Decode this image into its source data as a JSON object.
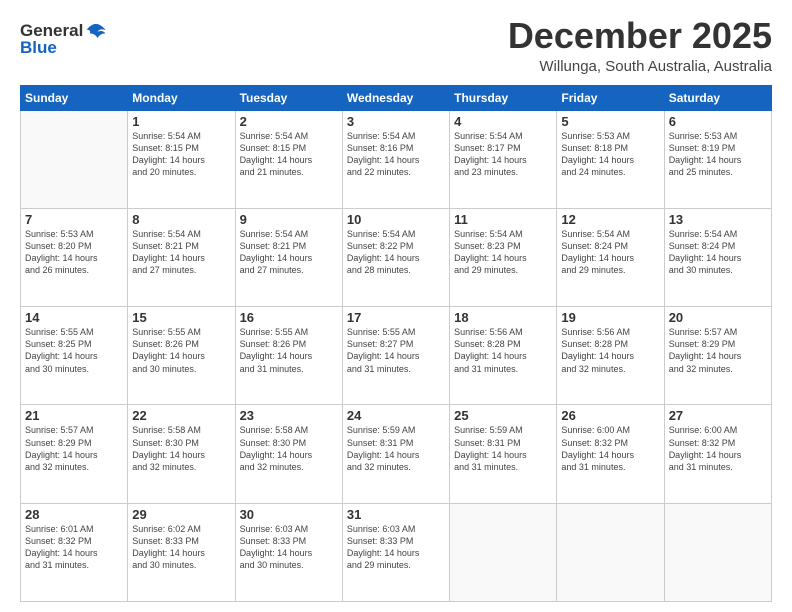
{
  "header": {
    "logo_general": "General",
    "logo_blue": "Blue",
    "title": "December 2025",
    "subtitle": "Willunga, South Australia, Australia"
  },
  "days_of_week": [
    "Sunday",
    "Monday",
    "Tuesday",
    "Wednesday",
    "Thursday",
    "Friday",
    "Saturday"
  ],
  "weeks": [
    [
      {
        "num": "",
        "info": ""
      },
      {
        "num": "1",
        "info": "Sunrise: 5:54 AM\nSunset: 8:15 PM\nDaylight: 14 hours\nand 20 minutes."
      },
      {
        "num": "2",
        "info": "Sunrise: 5:54 AM\nSunset: 8:15 PM\nDaylight: 14 hours\nand 21 minutes."
      },
      {
        "num": "3",
        "info": "Sunrise: 5:54 AM\nSunset: 8:16 PM\nDaylight: 14 hours\nand 22 minutes."
      },
      {
        "num": "4",
        "info": "Sunrise: 5:54 AM\nSunset: 8:17 PM\nDaylight: 14 hours\nand 23 minutes."
      },
      {
        "num": "5",
        "info": "Sunrise: 5:53 AM\nSunset: 8:18 PM\nDaylight: 14 hours\nand 24 minutes."
      },
      {
        "num": "6",
        "info": "Sunrise: 5:53 AM\nSunset: 8:19 PM\nDaylight: 14 hours\nand 25 minutes."
      }
    ],
    [
      {
        "num": "7",
        "info": "Sunrise: 5:53 AM\nSunset: 8:20 PM\nDaylight: 14 hours\nand 26 minutes."
      },
      {
        "num": "8",
        "info": "Sunrise: 5:54 AM\nSunset: 8:21 PM\nDaylight: 14 hours\nand 27 minutes."
      },
      {
        "num": "9",
        "info": "Sunrise: 5:54 AM\nSunset: 8:21 PM\nDaylight: 14 hours\nand 27 minutes."
      },
      {
        "num": "10",
        "info": "Sunrise: 5:54 AM\nSunset: 8:22 PM\nDaylight: 14 hours\nand 28 minutes."
      },
      {
        "num": "11",
        "info": "Sunrise: 5:54 AM\nSunset: 8:23 PM\nDaylight: 14 hours\nand 29 minutes."
      },
      {
        "num": "12",
        "info": "Sunrise: 5:54 AM\nSunset: 8:24 PM\nDaylight: 14 hours\nand 29 minutes."
      },
      {
        "num": "13",
        "info": "Sunrise: 5:54 AM\nSunset: 8:24 PM\nDaylight: 14 hours\nand 30 minutes."
      }
    ],
    [
      {
        "num": "14",
        "info": "Sunrise: 5:55 AM\nSunset: 8:25 PM\nDaylight: 14 hours\nand 30 minutes."
      },
      {
        "num": "15",
        "info": "Sunrise: 5:55 AM\nSunset: 8:26 PM\nDaylight: 14 hours\nand 30 minutes."
      },
      {
        "num": "16",
        "info": "Sunrise: 5:55 AM\nSunset: 8:26 PM\nDaylight: 14 hours\nand 31 minutes."
      },
      {
        "num": "17",
        "info": "Sunrise: 5:55 AM\nSunset: 8:27 PM\nDaylight: 14 hours\nand 31 minutes."
      },
      {
        "num": "18",
        "info": "Sunrise: 5:56 AM\nSunset: 8:28 PM\nDaylight: 14 hours\nand 31 minutes."
      },
      {
        "num": "19",
        "info": "Sunrise: 5:56 AM\nSunset: 8:28 PM\nDaylight: 14 hours\nand 32 minutes."
      },
      {
        "num": "20",
        "info": "Sunrise: 5:57 AM\nSunset: 8:29 PM\nDaylight: 14 hours\nand 32 minutes."
      }
    ],
    [
      {
        "num": "21",
        "info": "Sunrise: 5:57 AM\nSunset: 8:29 PM\nDaylight: 14 hours\nand 32 minutes."
      },
      {
        "num": "22",
        "info": "Sunrise: 5:58 AM\nSunset: 8:30 PM\nDaylight: 14 hours\nand 32 minutes."
      },
      {
        "num": "23",
        "info": "Sunrise: 5:58 AM\nSunset: 8:30 PM\nDaylight: 14 hours\nand 32 minutes."
      },
      {
        "num": "24",
        "info": "Sunrise: 5:59 AM\nSunset: 8:31 PM\nDaylight: 14 hours\nand 32 minutes."
      },
      {
        "num": "25",
        "info": "Sunrise: 5:59 AM\nSunset: 8:31 PM\nDaylight: 14 hours\nand 31 minutes."
      },
      {
        "num": "26",
        "info": "Sunrise: 6:00 AM\nSunset: 8:32 PM\nDaylight: 14 hours\nand 31 minutes."
      },
      {
        "num": "27",
        "info": "Sunrise: 6:00 AM\nSunset: 8:32 PM\nDaylight: 14 hours\nand 31 minutes."
      }
    ],
    [
      {
        "num": "28",
        "info": "Sunrise: 6:01 AM\nSunset: 8:32 PM\nDaylight: 14 hours\nand 31 minutes."
      },
      {
        "num": "29",
        "info": "Sunrise: 6:02 AM\nSunset: 8:33 PM\nDaylight: 14 hours\nand 30 minutes."
      },
      {
        "num": "30",
        "info": "Sunrise: 6:03 AM\nSunset: 8:33 PM\nDaylight: 14 hours\nand 30 minutes."
      },
      {
        "num": "31",
        "info": "Sunrise: 6:03 AM\nSunset: 8:33 PM\nDaylight: 14 hours\nand 29 minutes."
      },
      {
        "num": "",
        "info": ""
      },
      {
        "num": "",
        "info": ""
      },
      {
        "num": "",
        "info": ""
      }
    ]
  ]
}
